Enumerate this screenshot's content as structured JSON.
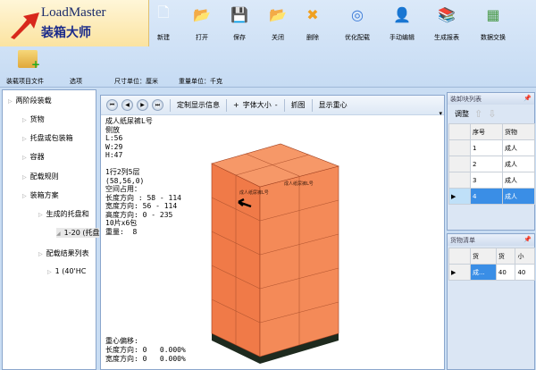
{
  "logo": {
    "en": "LoadMaster",
    "cn": "装箱大师"
  },
  "toolbar": [
    {
      "label": "新建",
      "icon": "new-file-icon"
    },
    {
      "label": "打开",
      "icon": "open-folder-icon"
    },
    {
      "label": "保存",
      "icon": "save-icon"
    },
    {
      "label": "关闭",
      "icon": "close-folder-icon"
    },
    {
      "label": "删除",
      "icon": "delete-icon"
    },
    {
      "label": "优化配载",
      "icon": "optimize-icon"
    },
    {
      "label": "手动编辑",
      "icon": "manual-edit-icon"
    },
    {
      "label": "生成报表",
      "icon": "report-icon"
    },
    {
      "label": "数据交换",
      "icon": "excel-icon"
    }
  ],
  "row2": {
    "project": "装载项目文件",
    "options": "选项",
    "size_unit": "尺寸单位：厘米",
    "weight_unit": "重量单位：千克"
  },
  "tree": [
    "两阶段装载",
    "货物",
    "托盘或包装箱",
    "容器",
    "配载规则",
    "装箱方案",
    "生成的托盘和",
    "1-20 (托盘",
    "配载结果列表",
    "1 (40'HC"
  ],
  "center": {
    "tools": {
      "custom": "定制显示信息",
      "plus": "+",
      "font": "字体大小",
      "minus": "-",
      "capture": "抓图",
      "cog": "显示重心"
    },
    "info": "成人纸尿裤L号\n侧放\nL:56\nW:29\nH:47\n\n1行2列5层\n(58,56,0)\n空间占用：\n长度方向 : 58 - 114\n宽度方向: 56 - 114\n高度方向: 0 - 235\n10片x6包\n重量:  8",
    "cog": "重心偏移:\n长度方向: 0   0.000%\n宽度方向: 0   0.000%",
    "box_label": "成人纸尿裤L号"
  },
  "unload": {
    "title": "装卸块列表",
    "adjust": "调整",
    "cols": [
      "序号",
      "货物"
    ],
    "rows": [
      [
        "1",
        "成人"
      ],
      [
        "2",
        "成人"
      ],
      [
        "3",
        "成人"
      ],
      [
        "4",
        "成人"
      ]
    ],
    "selected": 3
  },
  "goods": {
    "title": "货物清单",
    "cols": [
      "货",
      "货",
      "小"
    ],
    "row": [
      "成...",
      "40",
      "40"
    ]
  }
}
